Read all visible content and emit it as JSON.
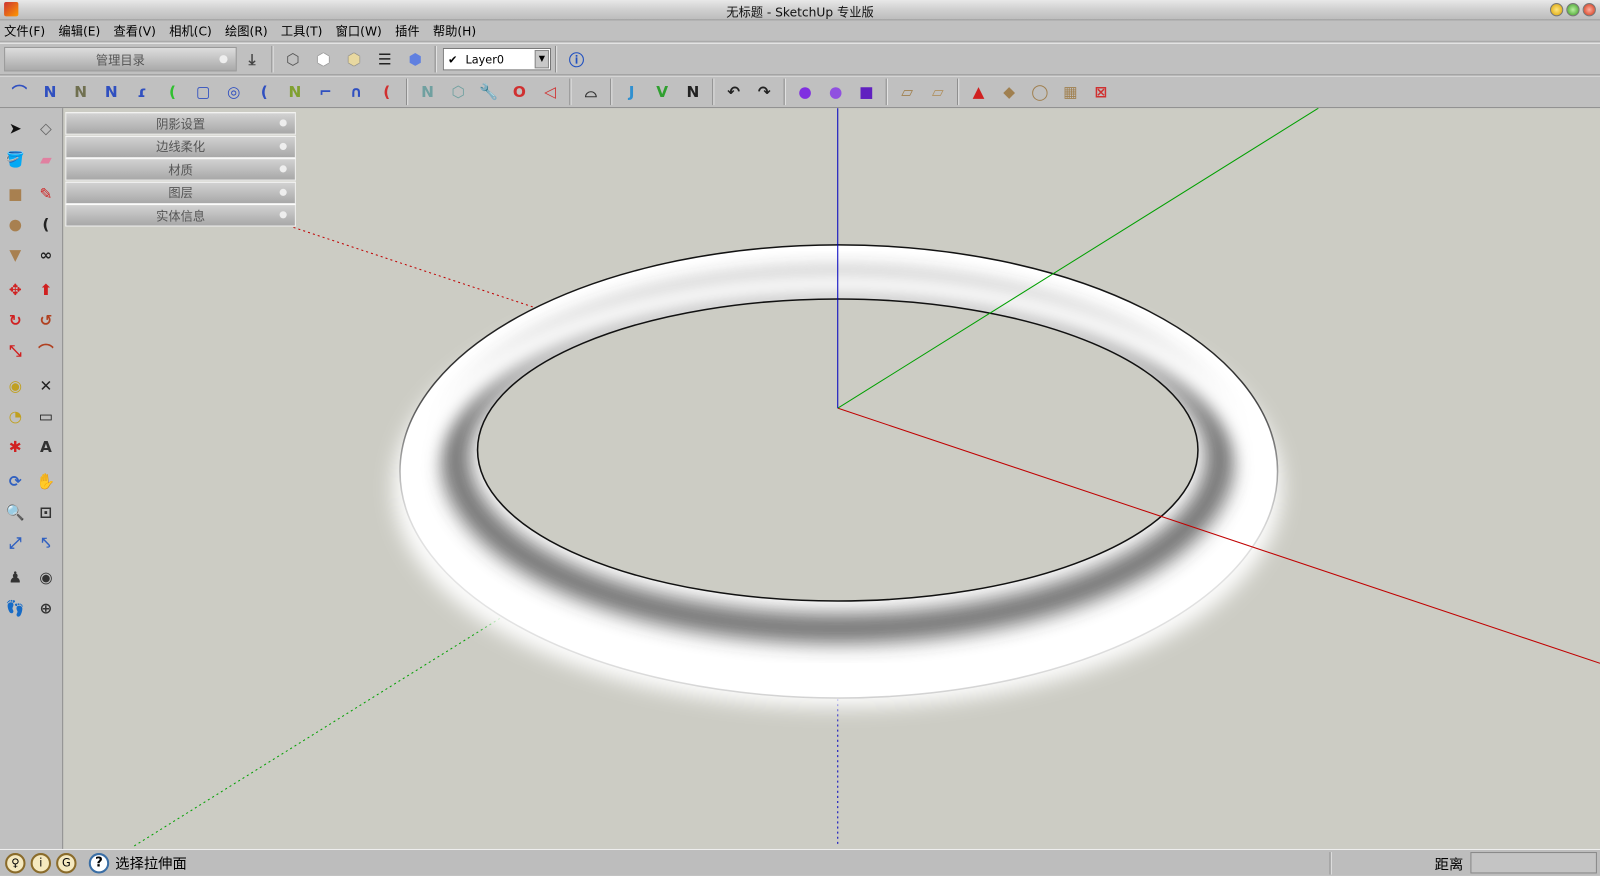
{
  "window": {
    "title": "无标题 - SketchUp 专业版"
  },
  "menu": [
    "文件(F)",
    "编辑(E)",
    "查看(V)",
    "相机(C)",
    "绘图(R)",
    "工具(T)",
    "窗口(W)",
    "插件",
    "帮助(H)"
  ],
  "toolbar1": {
    "catalog_label": "管理目录",
    "style_icons": [
      "xray-style-icon",
      "wireframe-style-icon",
      "hidden-line-style-icon",
      "shaded-style-icon",
      "shaded-texture-style-icon",
      "monochrome-style-icon"
    ],
    "layer": {
      "checked": "✔",
      "value": "Layer0"
    },
    "layer_manager_icon": "layer-manager-icon"
  },
  "toolbar2": {
    "icons": [
      {
        "name": "bezier-curve-icon",
        "glyph": "⌒",
        "color": "#3050c0"
      },
      {
        "name": "polyline-icon",
        "glyph": "N",
        "color": "#3050c0"
      },
      {
        "name": "freehand-polyline-icon",
        "glyph": "N",
        "color": "#707050"
      },
      {
        "name": "spline-icon",
        "glyph": "N",
        "color": "#3050c0"
      },
      {
        "name": "curve-join-icon",
        "glyph": "ɾ",
        "color": "#3050c0"
      },
      {
        "name": "arc-green-icon",
        "glyph": "(",
        "color": "#30c030"
      },
      {
        "name": "rectangle-curve-icon",
        "glyph": "▢",
        "color": "#3050c0"
      },
      {
        "name": "spiral-icon",
        "glyph": "◎",
        "color": "#3050c0"
      },
      {
        "name": "arc-icon",
        "glyph": "(",
        "color": "#3050c0"
      },
      {
        "name": "zigzag-icon",
        "glyph": "N",
        "color": "#80a030"
      },
      {
        "name": "hook-curve-icon",
        "glyph": "⌐",
        "color": "#3050c0"
      },
      {
        "name": "arch-icon",
        "glyph": "∩",
        "color": "#3050c0"
      },
      {
        "name": "red-arc-icon",
        "glyph": "(",
        "color": "#d03030"
      },
      {
        "sep": true
      },
      {
        "name": "line-segments-icon",
        "glyph": "N",
        "color": "#70a0a0"
      },
      {
        "name": "polygon-icon",
        "glyph": "⬡",
        "color": "#70a0a0"
      },
      {
        "name": "wrench-icon",
        "glyph": "🔧",
        "color": "#308030"
      },
      {
        "name": "oval-icon",
        "glyph": "O",
        "color": "#d03030"
      },
      {
        "name": "triangle-curve-icon",
        "glyph": "◁",
        "color": "#d03030"
      },
      {
        "sep": true
      },
      {
        "name": "loft-icon",
        "glyph": "⌓",
        "color": "#333"
      },
      {
        "sep": true
      },
      {
        "name": "joint-pushpull-icon",
        "glyph": "J",
        "color": "#3090d0"
      },
      {
        "name": "vector-pushpull-icon",
        "glyph": "V",
        "color": "#30a030"
      },
      {
        "name": "normal-pushpull-icon",
        "glyph": "N",
        "color": "#222"
      },
      {
        "sep": true
      },
      {
        "name": "undo-pushpull-icon",
        "glyph": "↶",
        "color": "#222"
      },
      {
        "name": "redo-pushpull-icon",
        "glyph": "↷",
        "color": "#222"
      },
      {
        "sep": true
      },
      {
        "name": "solid-sphere-icon",
        "glyph": "●",
        "color": "#8030e0"
      },
      {
        "name": "solid-shell-icon",
        "glyph": "●",
        "color": "#9050e0"
      },
      {
        "name": "solid-cube-icon",
        "glyph": "■",
        "color": "#6020c0"
      },
      {
        "sep": true
      },
      {
        "name": "sandbox-contours-icon",
        "glyph": "▱",
        "color": "#a08050"
      },
      {
        "name": "sandbox-scratch-icon",
        "glyph": "▱",
        "color": "#b09060"
      },
      {
        "sep": true
      },
      {
        "name": "smoove-icon",
        "glyph": "▲",
        "color": "#d02020"
      },
      {
        "name": "stamp-icon",
        "glyph": "◆",
        "color": "#a08050"
      },
      {
        "name": "drape-icon",
        "glyph": "◯",
        "color": "#a08050"
      },
      {
        "name": "add-detail-icon",
        "glyph": "▦",
        "color": "#a08050"
      },
      {
        "name": "flip-edge-icon",
        "glyph": "⊠",
        "color": "#d03030"
      }
    ]
  },
  "left_toolbar": [
    {
      "name": "select-icon",
      "glyph": "➤",
      "color": "#111"
    },
    {
      "name": "make-component-icon",
      "glyph": "◇",
      "color": "#666"
    },
    {
      "name": "paint-bucket-icon",
      "glyph": "🪣",
      "color": "#c0a020"
    },
    {
      "name": "eraser-icon",
      "glyph": "▰",
      "color": "#e080a0"
    },
    {
      "name": "rectangle-icon",
      "glyph": "■",
      "color": "#a88050"
    },
    {
      "name": "pencil-icon",
      "glyph": "✎",
      "color": "#d02020"
    },
    {
      "name": "circle-icon",
      "glyph": "●",
      "color": "#a88050"
    },
    {
      "name": "arc-tool-icon",
      "glyph": "(",
      "color": "#222"
    },
    {
      "name": "polygon-tool-icon",
      "glyph": "▼",
      "color": "#a88050"
    },
    {
      "name": "freehand-icon",
      "glyph": "∞",
      "color": "#222"
    },
    {
      "name": "move-icon",
      "glyph": "✥",
      "color": "#d02020"
    },
    {
      "name": "push-pull-icon",
      "glyph": "⬆",
      "color": "#d02020"
    },
    {
      "name": "rotate-icon",
      "glyph": "↻",
      "color": "#d02020"
    },
    {
      "name": "follow-me-icon",
      "glyph": "↺",
      "color": "#b04020"
    },
    {
      "name": "scale-icon",
      "glyph": "⤡",
      "color": "#d02020"
    },
    {
      "name": "offset-icon",
      "glyph": "⌒",
      "color": "#b04020"
    },
    {
      "name": "tape-measure-icon",
      "glyph": "◉",
      "color": "#c0a020"
    },
    {
      "name": "dimension-icon",
      "glyph": "✕",
      "color": "#222"
    },
    {
      "name": "protractor-icon",
      "glyph": "◔",
      "color": "#c0a020"
    },
    {
      "name": "text-tool-icon",
      "glyph": "▭",
      "color": "#222"
    },
    {
      "name": "axes-icon",
      "glyph": "✱",
      "color": "#d02020"
    },
    {
      "name": "3d-text-icon",
      "glyph": "A",
      "color": "#333"
    },
    {
      "name": "orbit-icon",
      "glyph": "⟳",
      "color": "#3060c0"
    },
    {
      "name": "pan-icon",
      "glyph": "✋",
      "color": "#333"
    },
    {
      "name": "zoom-icon",
      "glyph": "🔍",
      "color": "#333"
    },
    {
      "name": "zoom-window-icon",
      "glyph": "⊡",
      "color": "#333"
    },
    {
      "name": "zoom-extents-icon",
      "glyph": "⤢",
      "color": "#3060c0"
    },
    {
      "name": "previous-view-icon",
      "glyph": "⤣",
      "color": "#3060c0"
    },
    {
      "name": "position-camera-icon",
      "glyph": "♟",
      "color": "#333"
    },
    {
      "name": "look-around-icon",
      "glyph": "◉",
      "color": "#333"
    },
    {
      "name": "walk-icon",
      "glyph": "👣",
      "color": "#333"
    },
    {
      "name": "section-plane-icon",
      "glyph": "⊕",
      "color": "#333"
    }
  ],
  "trays": [
    "阴影设置",
    "边线柔化",
    "材质",
    "图层",
    "实体信息"
  ],
  "status": {
    "icons": [
      "geo-location-icon",
      "credits-icon",
      "sign-in-icon"
    ],
    "message": "选择拉伸面",
    "measurement_label": "距离",
    "measurement_value": ""
  },
  "scene": {
    "colors": {
      "red_axis": "#c00000",
      "green_axis": "#00a000",
      "blue_axis": "#0000c0",
      "background": "#ccccc4",
      "model": "#ffffff"
    }
  }
}
